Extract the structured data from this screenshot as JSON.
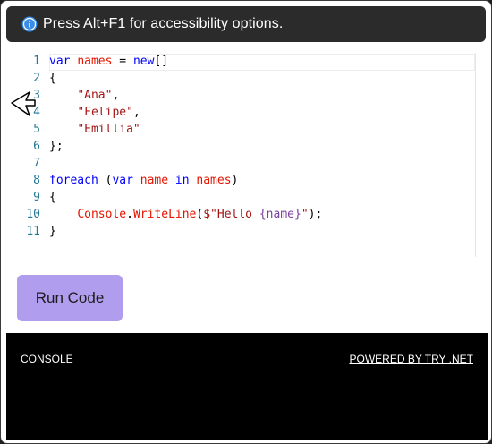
{
  "banner": {
    "text": "Press Alt+F1 for accessibility options."
  },
  "editor": {
    "line_numbers": [
      "1",
      "2",
      "3",
      "4",
      "5",
      "6",
      "7",
      "8",
      "9",
      "10",
      "11"
    ],
    "lines": [
      [
        {
          "t": "var",
          "c": "kw"
        },
        {
          "t": " ",
          "c": ""
        },
        {
          "t": "names",
          "c": "red"
        },
        {
          "t": " = ",
          "c": ""
        },
        {
          "t": "new",
          "c": "kw"
        },
        {
          "t": "[]",
          "c": ""
        }
      ],
      [
        {
          "t": "{",
          "c": ""
        }
      ],
      [
        {
          "t": "    ",
          "c": ""
        },
        {
          "t": "\"Ana\"",
          "c": "str"
        },
        {
          "t": ",",
          "c": ""
        }
      ],
      [
        {
          "t": "    ",
          "c": ""
        },
        {
          "t": "\"Felipe\"",
          "c": "str"
        },
        {
          "t": ",",
          "c": ""
        }
      ],
      [
        {
          "t": "    ",
          "c": ""
        },
        {
          "t": "\"Emillia\"",
          "c": "str"
        }
      ],
      [
        {
          "t": "};",
          "c": ""
        }
      ],
      [],
      [
        {
          "t": "foreach",
          "c": "kw"
        },
        {
          "t": " (",
          "c": ""
        },
        {
          "t": "var",
          "c": "kw"
        },
        {
          "t": " ",
          "c": ""
        },
        {
          "t": "name",
          "c": "red"
        },
        {
          "t": " ",
          "c": ""
        },
        {
          "t": "in",
          "c": "kw"
        },
        {
          "t": " ",
          "c": ""
        },
        {
          "t": "names",
          "c": "red"
        },
        {
          "t": ")",
          "c": ""
        }
      ],
      [
        {
          "t": "{",
          "c": ""
        }
      ],
      [
        {
          "t": "    ",
          "c": ""
        },
        {
          "t": "Console",
          "c": "red"
        },
        {
          "t": ".",
          "c": ""
        },
        {
          "t": "WriteLine",
          "c": "red"
        },
        {
          "t": "(",
          "c": ""
        },
        {
          "t": "$\"Hello ",
          "c": "str"
        },
        {
          "t": "{name}",
          "c": "pur"
        },
        {
          "t": "\"",
          "c": "str"
        },
        {
          "t": ");",
          "c": ""
        }
      ],
      [
        {
          "t": "}",
          "c": ""
        }
      ]
    ]
  },
  "run_button": {
    "label": "Run Code"
  },
  "console": {
    "label": "CONSOLE",
    "powered_by": "POWERED BY TRY .NET"
  },
  "colors": {
    "run_button_bg": "#b19ded",
    "banner_bg": "#2b2b2b",
    "console_bg": "#000000"
  },
  "icons": {
    "banner_icon": "info-icon",
    "cursor": "arrow-pointer-icon"
  }
}
